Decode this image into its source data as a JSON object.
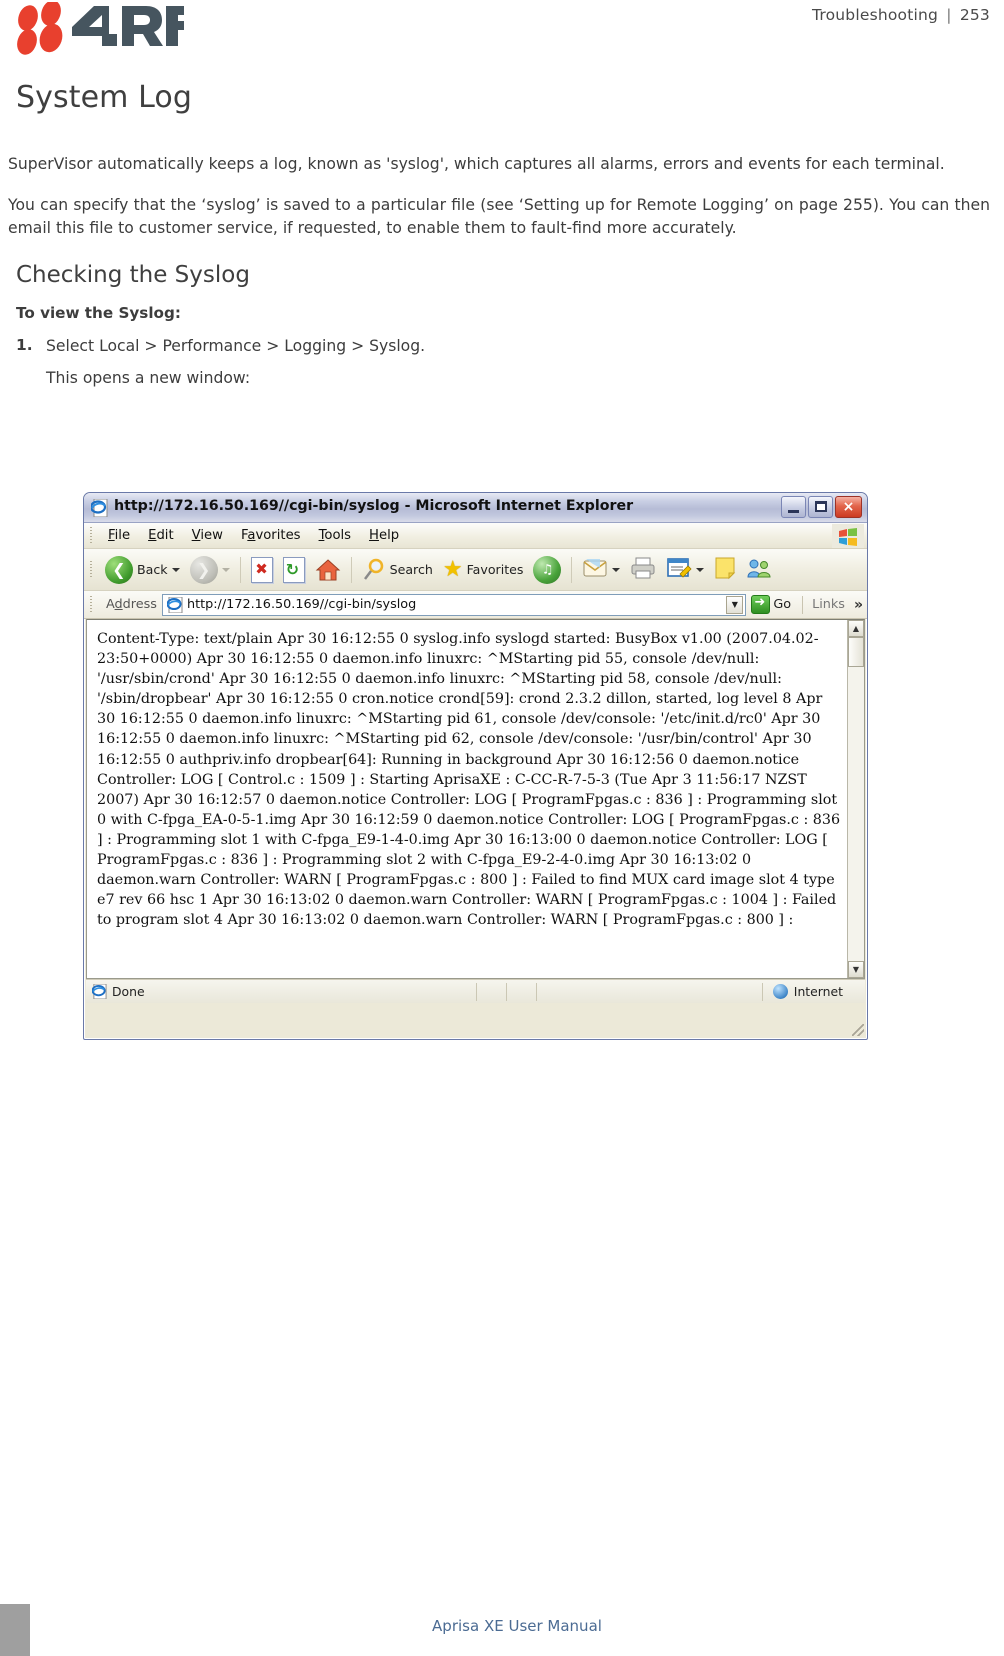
{
  "header": {
    "logo_alt": "4RF",
    "logo_text": "4RF",
    "section": "Troubleshooting",
    "separator": "|",
    "page_number": "253"
  },
  "page_title": "System Log",
  "paragraphs": [
    "SuperVisor automatically keeps a log, known as 'syslog', which captures all alarms, errors and events for each terminal.",
    "You can specify that the ‘syslog’ is saved to a particular file (see ‘Setting up for Remote Logging’ on page 255). You can then email this file to customer service, if requested, to enable them to fault-find more accurately."
  ],
  "section_heading": "Checking the Syslog",
  "procedure": {
    "lead": "To view the Syslog:",
    "step_number": "1.",
    "step_text": "Select Local > Performance > Logging > Syslog.",
    "step_followup": "This opens a new window:"
  },
  "browser": {
    "title": "http://172.16.50.169//cgi-bin/syslog - Microsoft Internet Explorer",
    "window_buttons": {
      "minimize": "minimize-button",
      "maximize": "maximize-button",
      "close": "×"
    },
    "menu": [
      {
        "pre": "",
        "accel": "F",
        "post": "ile"
      },
      {
        "pre": "",
        "accel": "E",
        "post": "dit"
      },
      {
        "pre": "",
        "accel": "V",
        "post": "iew"
      },
      {
        "pre": "F",
        "accel": "a",
        "post": "vorites"
      },
      {
        "pre": "",
        "accel": "T",
        "post": "ools"
      },
      {
        "pre": "",
        "accel": "H",
        "post": "elp"
      }
    ],
    "toolbar": {
      "back": "Back",
      "search": "Search",
      "favorites": "Favorites"
    },
    "address": {
      "label_pre": "A",
      "label_accel": "d",
      "label_post": "dress",
      "value": "http://172.16.50.169//cgi-bin/syslog",
      "go": "Go",
      "links": "Links",
      "chevron": "»"
    },
    "log_content": "Content-Type: text/plain Apr 30 16:12:55 0 syslog.info syslogd started: BusyBox v1.00 (2007.04.02-23:50+0000) Apr 30 16:12:55 0 daemon.info linuxrc: ^MStarting pid 55, console /dev/null: '/usr/sbin/crond' Apr 30 16:12:55 0 daemon.info linuxrc: ^MStarting pid 58, console /dev/null: '/sbin/dropbear' Apr 30 16:12:55 0 cron.notice crond[59]: crond 2.3.2 dillon, started, log level 8 Apr 30 16:12:55 0 daemon.info linuxrc: ^MStarting pid 61, console /dev/console: '/etc/init.d/rc0' Apr 30 16:12:55 0 daemon.info linuxrc: ^MStarting pid 62, console /dev/console: '/usr/bin/control' Apr 30 16:12:55 0 authpriv.info dropbear[64]: Running in background Apr 30 16:12:56 0 daemon.notice Controller: LOG [ Control.c : 1509 ] : Starting AprisaXE : C-CC-R-7-5-3 (Tue Apr 3 11:56:17 NZST 2007) Apr 30 16:12:57 0 daemon.notice Controller: LOG [ ProgramFpgas.c : 836 ] : Programming slot 0 with C-fpga_EA-0-5-1.img Apr 30 16:12:59 0 daemon.notice Controller: LOG [ ProgramFpgas.c : 836 ] : Programming slot 1 with C-fpga_E9-1-4-0.img Apr 30 16:13:00 0 daemon.notice Controller: LOG [ ProgramFpgas.c : 836 ] : Programming slot 2 with C-fpga_E9-2-4-0.img Apr 30 16:13:02 0 daemon.warn Controller: WARN [ ProgramFpgas.c : 800 ] : Failed to find MUX card image slot 4 type e7 rev 66 hsc 1 Apr 30 16:13:02 0 daemon.warn Controller: WARN [ ProgramFpgas.c : 1004 ] : Failed to program slot 4 Apr 30 16:13:02 0 daemon.warn Controller: WARN [ ProgramFpgas.c : 800 ] :",
    "status": {
      "left": "Done",
      "right": "Internet"
    }
  },
  "footer": {
    "text": "Aprisa XE User Manual"
  },
  "colors": {
    "logo_red": "#e8402e",
    "logo_dark": "#46555f",
    "heading": "#3f3f3f",
    "footer_text": "#4b6b93",
    "footer_bar": "#9f9f9f"
  }
}
